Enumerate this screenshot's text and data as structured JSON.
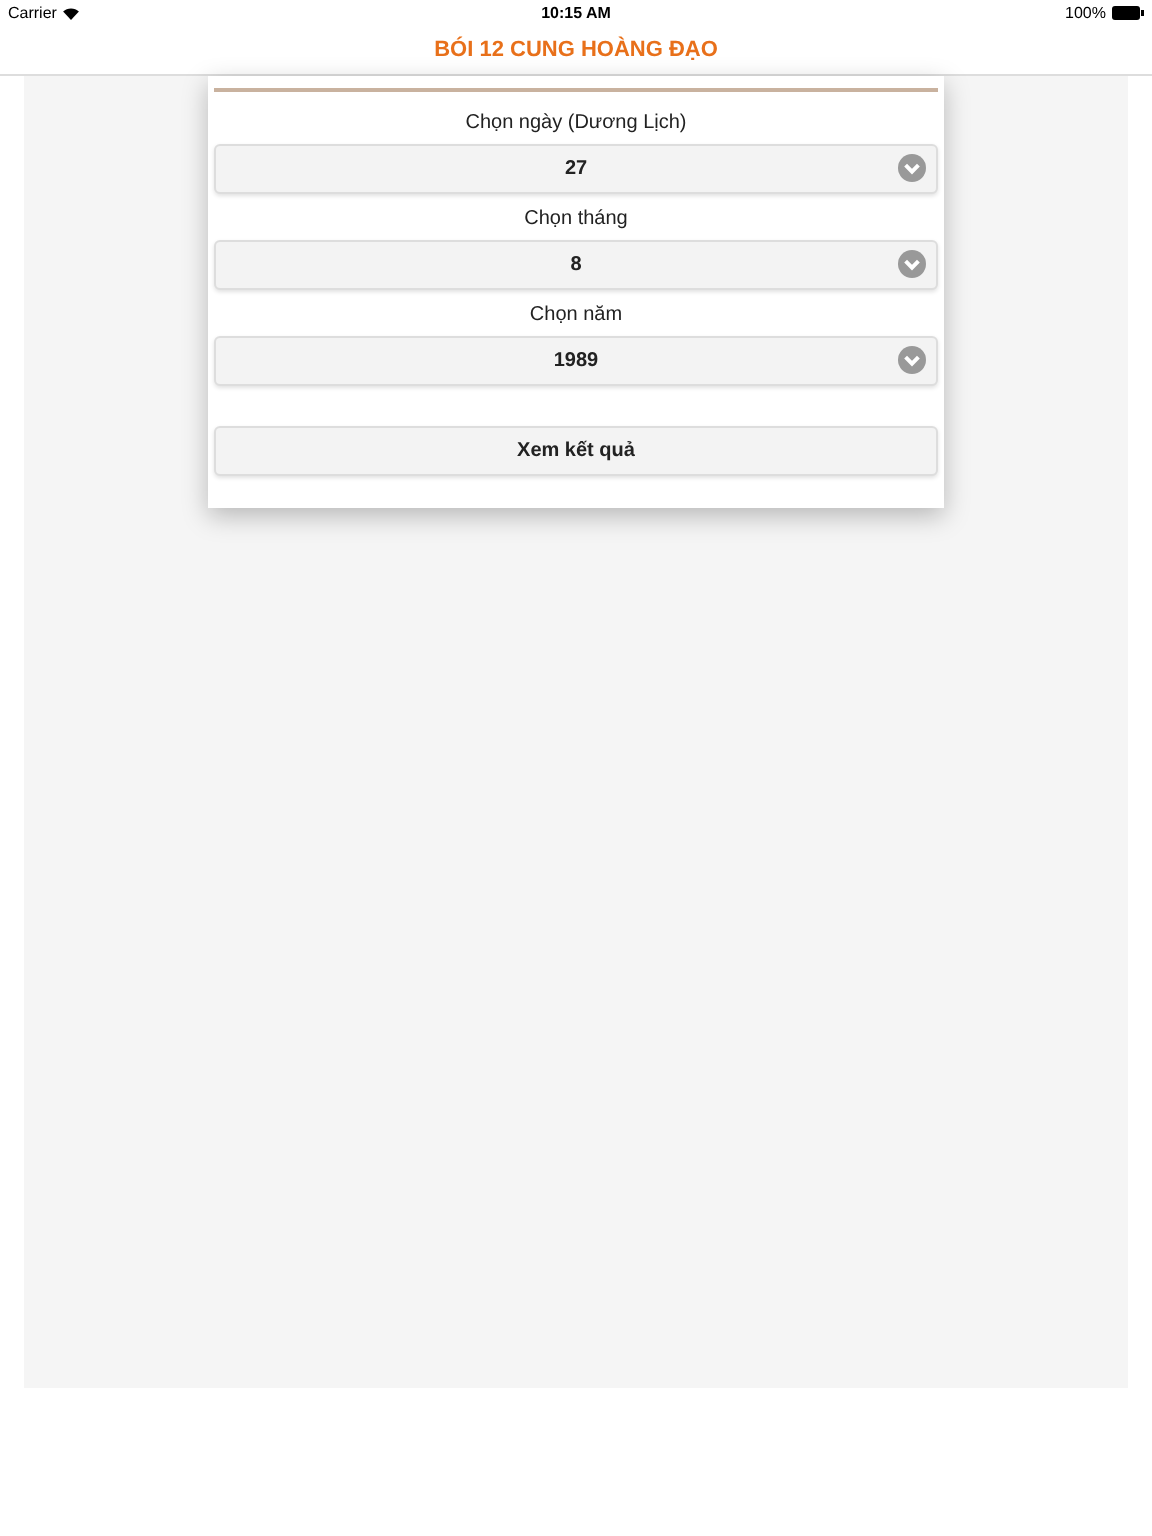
{
  "status_bar": {
    "carrier": "Carrier",
    "time": "10:15 AM",
    "battery": "100%"
  },
  "nav": {
    "title": "BÓI 12 CUNG HOÀNG ĐẠO"
  },
  "form": {
    "fields": [
      {
        "label": "Chọn ngày (Dương Lịch)",
        "value": "27"
      },
      {
        "label": "Chọn tháng",
        "value": "8"
      },
      {
        "label": "Chọn năm",
        "value": "1989"
      }
    ],
    "submit": "Xem kết quả"
  }
}
